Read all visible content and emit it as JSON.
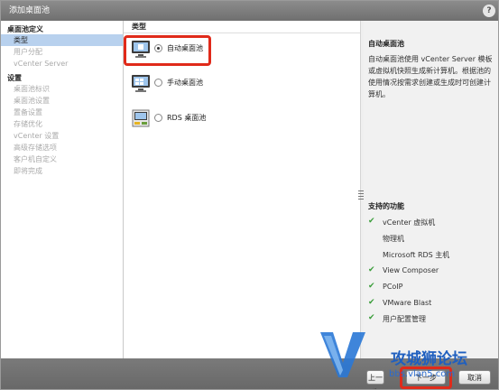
{
  "dialog": {
    "title": "添加桌面池",
    "help_label": "?"
  },
  "nav": {
    "section1": "桌面池定义",
    "steps1": [
      "类型",
      "用户分配",
      "vCenter Server"
    ],
    "section2": "设置",
    "steps2": [
      "桌面池标识",
      "桌面池设置",
      "置备设置",
      "存储优化",
      "vCenter 设置",
      "高级存储选项",
      "客户机自定义",
      "即将完成"
    ]
  },
  "main": {
    "title": "类型",
    "options": [
      {
        "label": "自动桌面池",
        "selected": true,
        "icon": "auto-pool-icon"
      },
      {
        "label": "手动桌面池",
        "selected": false,
        "icon": "manual-pool-icon"
      },
      {
        "label": "RDS 桌面池",
        "selected": false,
        "icon": "rds-pool-icon"
      }
    ]
  },
  "side": {
    "title": "自动桌面池",
    "description": "自动桌面池使用 vCenter Server 模板或虚拟机快照生成新计算机。根据池的使用情况按需求创建或生成时可创建计算机。",
    "features_title": "支持的功能",
    "features": [
      {
        "label": "vCenter 虚拟机",
        "supported": true
      },
      {
        "label": "物理机",
        "supported": false
      },
      {
        "label": "Microsoft RDS 主机",
        "supported": false
      },
      {
        "label": "View Composer",
        "supported": true
      },
      {
        "label": "PCoIP",
        "supported": true
      },
      {
        "label": "VMware Blast",
        "supported": true
      },
      {
        "label": "用户配置管理",
        "supported": true
      }
    ]
  },
  "footer": {
    "prev_label": "上一步",
    "next_label": "下一步",
    "cancel_label": "取消"
  },
  "watermark": {
    "text": "攻城狮论坛",
    "url": "bbs.vlan5.com"
  },
  "colors": {
    "accent_select": "#b8d1ee",
    "highlight": "#e02a1a",
    "check": "#3a9d3a"
  }
}
